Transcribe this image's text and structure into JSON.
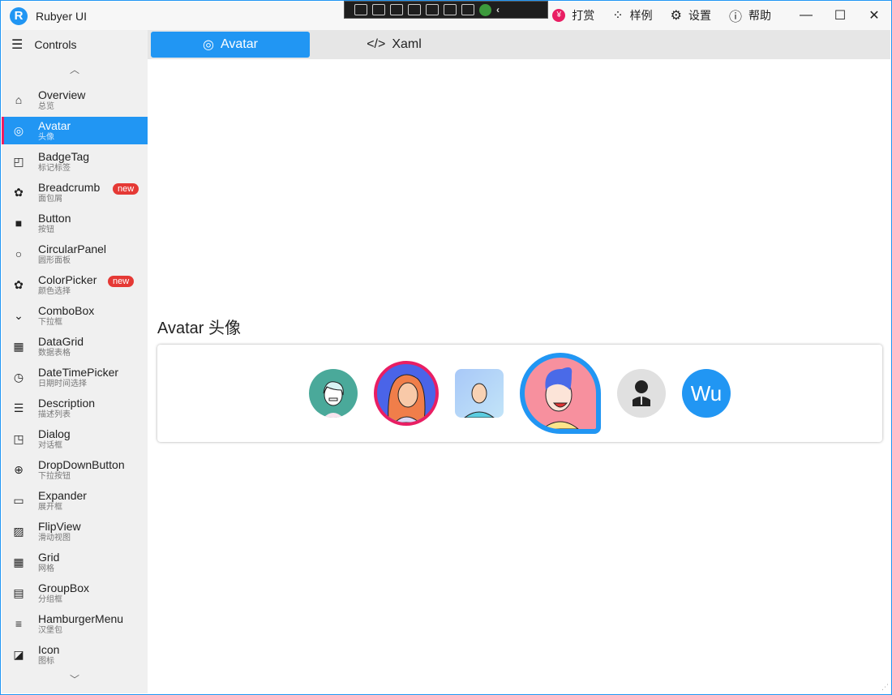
{
  "window": {
    "title": "Rubyer UI",
    "logo_letter": "R",
    "accent": "#2196f3"
  },
  "titlebar": {
    "buttons": [
      {
        "icon": "yen-icon",
        "label": "打赏"
      },
      {
        "icon": "grid-icon",
        "label": "样例"
      },
      {
        "icon": "gear-icon",
        "label": "设置"
      },
      {
        "icon": "help-icon",
        "label": "帮助"
      }
    ]
  },
  "sidebar": {
    "header": "Controls",
    "items": [
      {
        "label": "Overview",
        "sub": "总览",
        "icon": "⌂"
      },
      {
        "label": "Avatar",
        "sub": "头像",
        "icon": "◎",
        "active": true
      },
      {
        "label": "BadgeTag",
        "sub": "标记标签",
        "icon": "◰"
      },
      {
        "label": "Breadcrumb",
        "sub": "面包屑",
        "icon": "✿",
        "badge": "new"
      },
      {
        "label": "Button",
        "sub": "按钮",
        "icon": "■"
      },
      {
        "label": "CircularPanel",
        "sub": "圆形面板",
        "icon": "○"
      },
      {
        "label": "ColorPicker",
        "sub": "颜色选择",
        "icon": "✿",
        "badge": "new"
      },
      {
        "label": "ComboBox",
        "sub": "下拉框",
        "icon": "⌄"
      },
      {
        "label": "DataGrid",
        "sub": "数据表格",
        "icon": "▦"
      },
      {
        "label": "DateTimePicker",
        "sub": "日期时间选择",
        "icon": "◷"
      },
      {
        "label": "Description",
        "sub": "描述列表",
        "icon": "☰"
      },
      {
        "label": "Dialog",
        "sub": "对话框",
        "icon": "◳"
      },
      {
        "label": "DropDownButton",
        "sub": "下拉按钮",
        "icon": "⊕"
      },
      {
        "label": "Expander",
        "sub": "展开框",
        "icon": "▭"
      },
      {
        "label": "FlipView",
        "sub": "滑动视图",
        "icon": "▨"
      },
      {
        "label": "Grid",
        "sub": "网格",
        "icon": "▦"
      },
      {
        "label": "GroupBox",
        "sub": "分组框",
        "icon": "▤"
      },
      {
        "label": "HamburgerMenu",
        "sub": "汉堡包",
        "icon": "≡"
      },
      {
        "label": "Icon",
        "sub": "图标",
        "icon": "◪"
      }
    ]
  },
  "tabs": [
    {
      "label": "Avatar",
      "active": true
    },
    {
      "label": "Xaml"
    }
  ],
  "section": {
    "title": "Avatar 头像",
    "text_avatar": "Wu"
  }
}
